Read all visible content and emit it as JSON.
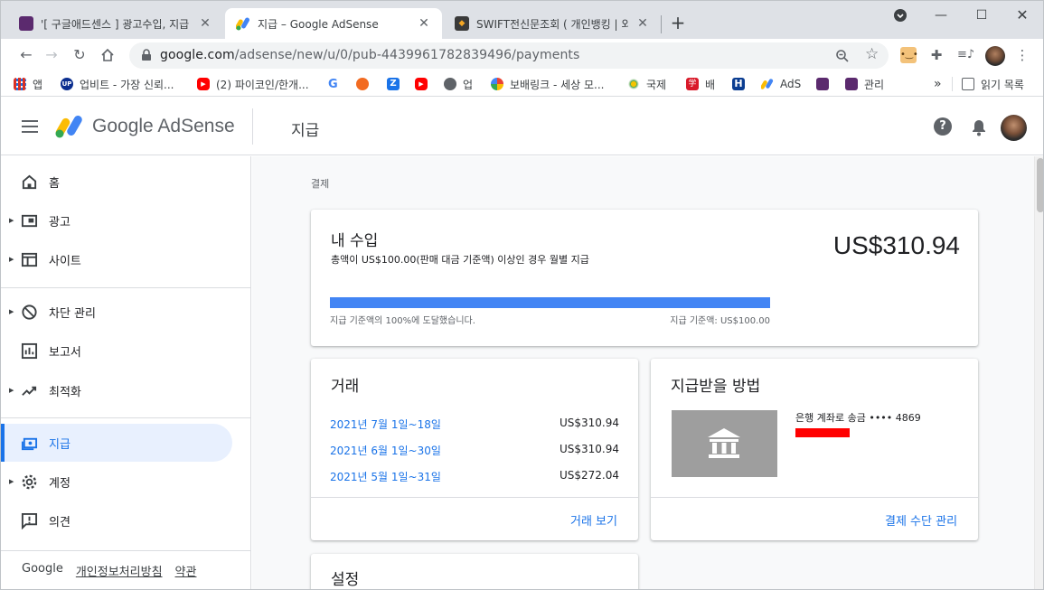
{
  "tabs": [
    {
      "title": "'[ 구글애드센스 ] 광고수입, 지급"
    },
    {
      "title": "지급 – Google AdSense"
    },
    {
      "title": "SWIFT전신문조회 ( 개인뱅킹 | 외"
    }
  ],
  "address": {
    "host": "google.com",
    "path": "/adsense/new/u/0/pub-4439961782839496/payments"
  },
  "bookmarks": [
    {
      "label": "앱"
    },
    {
      "label": "업비트 - 가장 신뢰..."
    },
    {
      "label": "(2) 파이코인/한개..."
    },
    {
      "label": "업"
    },
    {
      "label": "보배링크 - 세상 모..."
    },
    {
      "label": "국제"
    },
    {
      "label": "배"
    },
    {
      "label": "AdS"
    },
    {
      "label": "관리"
    }
  ],
  "bookmarks_more": "»",
  "reading_list": "읽기 목록",
  "app": {
    "brand": "Google AdSense",
    "page_title": "지급"
  },
  "sidebar": {
    "items": [
      {
        "label": "홈"
      },
      {
        "label": "광고"
      },
      {
        "label": "사이트"
      },
      {
        "label": "차단 관리"
      },
      {
        "label": "보고서"
      },
      {
        "label": "최적화"
      },
      {
        "label": "지급"
      },
      {
        "label": "계정"
      },
      {
        "label": "의견"
      }
    ],
    "footer": {
      "google": "Google",
      "privacy": "개인정보처리방침",
      "terms": "약관"
    }
  },
  "breadcrumb": "결제",
  "earnings": {
    "title": "내 수입",
    "subtitle": "총액이 US$100.00(판매 대금 기준액) 이상인 경우 월별 지급",
    "amount": "US$310.94",
    "progress": 1.0,
    "progress_left": "지급 기준액의 100%에 도달했습니다.",
    "progress_right": "지급 기준액: US$100.00"
  },
  "transactions": {
    "title": "거래",
    "rows": [
      {
        "date": "2021년 7월 1일~18일",
        "amount": "US$310.94"
      },
      {
        "date": "2021년 6월 1일~30일",
        "amount": "US$310.94"
      },
      {
        "date": "2021년 5월 1일~31일",
        "amount": "US$272.04"
      }
    ],
    "link": "거래 보기"
  },
  "payment_method": {
    "title": "지급받을 방법",
    "bank_text": "은행 계좌로 송금 •••• 4869",
    "link": "결제 수단 관리"
  },
  "settings": {
    "title": "설정"
  },
  "colors": {
    "accent": "#1a73e8",
    "progress": "#4285f4",
    "active_bg": "#e8f0fe"
  }
}
